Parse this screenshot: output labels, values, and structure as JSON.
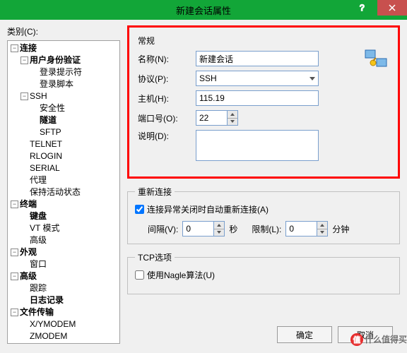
{
  "window": {
    "title": "新建会话属性"
  },
  "left": {
    "label": "类别(C):"
  },
  "tree": {
    "connection": {
      "label": "连接",
      "children": {
        "auth": {
          "label": "用户身份验证",
          "children": {
            "prompt": {
              "label": "登录提示符"
            },
            "script": {
              "label": "登录脚本"
            }
          }
        },
        "ssh": {
          "label": "SSH",
          "children": {
            "security": {
              "label": "安全性"
            },
            "tunnel": {
              "label": "隧道"
            },
            "sftp": {
              "label": "SFTP"
            }
          }
        },
        "telnet": {
          "label": "TELNET"
        },
        "rlogin": {
          "label": "RLOGIN"
        },
        "serial": {
          "label": "SERIAL"
        },
        "proxy": {
          "label": "代理"
        },
        "keep": {
          "label": "保持活动状态"
        }
      }
    },
    "terminal": {
      "label": "终端",
      "children": {
        "keyboard": {
          "label": "键盘"
        },
        "vt": {
          "label": "VT 模式"
        },
        "adv": {
          "label": "高级"
        }
      }
    },
    "appearance": {
      "label": "外观",
      "children": {
        "window": {
          "label": "窗口"
        }
      }
    },
    "advanced": {
      "label": "高级",
      "children": {
        "trace": {
          "label": "跟踪"
        },
        "log": {
          "label": "日志记录"
        }
      }
    },
    "filetransfer": {
      "label": "文件传输",
      "children": {
        "xy": {
          "label": "X/YMODEM"
        },
        "z": {
          "label": "ZMODEM"
        }
      }
    }
  },
  "general": {
    "heading": "常规",
    "name_label": "名称(N):",
    "name_value": "新建会话",
    "protocol_label": "协议(P):",
    "protocol_value": "SSH",
    "host_label": "主机(H):",
    "host_value": "115.19",
    "port_label": "端口号(O):",
    "port_value": "22",
    "desc_label": "说明(D):"
  },
  "reconnect": {
    "heading": "重新连接",
    "checkbox_label": "连接异常关闭时自动重新连接(A)",
    "interval_label": "间隔(V):",
    "interval_value": "0",
    "interval_unit": "秒",
    "limit_label": "限制(L):",
    "limit_value": "0",
    "limit_unit": "分钟"
  },
  "tcp": {
    "heading": "TCP选项",
    "nagle_label": "使用Nagle算法(U)"
  },
  "buttons": {
    "ok": "确定",
    "cancel": "取消"
  },
  "watermark": {
    "badge": "值",
    "text": "什么值得买"
  }
}
